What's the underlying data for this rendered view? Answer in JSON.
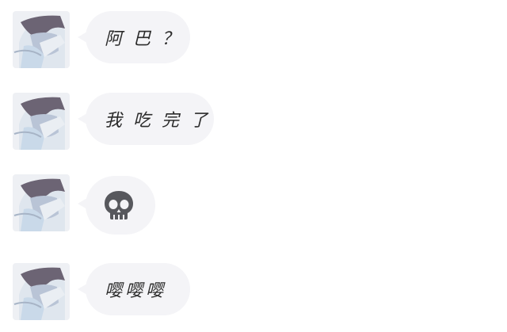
{
  "chat": {
    "messages": [
      {
        "type": "text",
        "text": "阿巴？"
      },
      {
        "type": "text",
        "text": "我吃完了"
      },
      {
        "type": "emoji",
        "icon": "skull-icon"
      },
      {
        "type": "text",
        "text": "嘤嘤嘤"
      }
    ]
  }
}
